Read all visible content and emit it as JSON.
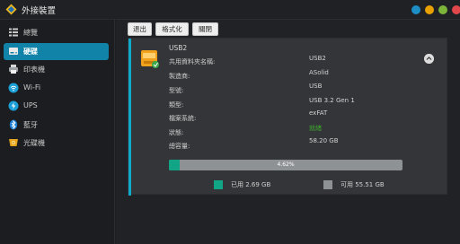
{
  "app": {
    "title": "外接裝置"
  },
  "window_controls": [
    {
      "name": "help",
      "color": "#1e8ec6"
    },
    {
      "name": "minimize",
      "color": "#e8a100"
    },
    {
      "name": "maximize",
      "color": "#7db53a"
    },
    {
      "name": "close",
      "color": "#e2484b"
    }
  ],
  "sidebar": {
    "items": [
      {
        "label": "總覽",
        "icon": "overview-icon"
      },
      {
        "label": "硬碟",
        "icon": "disk-icon",
        "active": true
      },
      {
        "label": "印表機",
        "icon": "printer-icon"
      },
      {
        "label": "Wi-Fi",
        "icon": "wifi-icon"
      },
      {
        "label": "UPS",
        "icon": "ups-icon"
      },
      {
        "label": "藍牙",
        "icon": "bluetooth-icon"
      },
      {
        "label": "光碟機",
        "icon": "optical-drive-icon"
      }
    ]
  },
  "toolbar": {
    "eject": "退出",
    "format": "格式化",
    "close": "關閉"
  },
  "device": {
    "name": "USB2",
    "rows": [
      {
        "label": "共用資料夾名稱:",
        "value": "USB2"
      },
      {
        "label": "製造商:",
        "value": "ASolid"
      },
      {
        "label": "型號:",
        "value": "USB"
      },
      {
        "label": "類型:",
        "value": "USB 3.2 Gen 1"
      },
      {
        "label": "檔案系統:",
        "value": "exFAT"
      },
      {
        "label": "狀態:",
        "value": "就緒"
      },
      {
        "label": "總容量:",
        "value": "58.20 GB"
      }
    ],
    "usage_percent_text": "4.62%",
    "usage_fraction": 0.0462,
    "used_label": "已用 2.69 GB",
    "free_label": "可用 55.51 GB",
    "used_color": "#12a585",
    "free_color": "#8f9295"
  }
}
